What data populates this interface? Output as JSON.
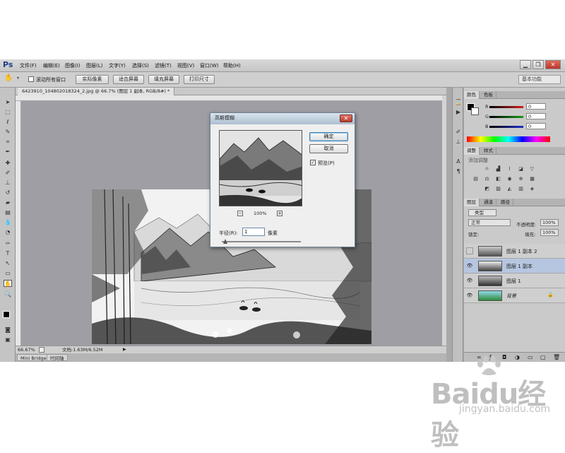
{
  "app": {
    "logo": "Ps"
  },
  "menu": [
    "文件(F)",
    "编辑(E)",
    "图像(I)",
    "图层(L)",
    "文字(Y)",
    "选择(S)",
    "滤镜(T)",
    "视图(V)",
    "窗口(W)",
    "帮助(H)"
  ],
  "window_controls": {
    "minimize": "▁",
    "restore": "❐",
    "close": "✕"
  },
  "options": {
    "scroll_all_label": "滚动所有窗口",
    "buttons": [
      "实际像素",
      "适合屏幕",
      "填充屏幕",
      "打印尺寸"
    ],
    "workspace": "基本功能"
  },
  "document": {
    "tab_title": "6423910_104802018324_2.jpg @ 66.7% (图层 1 副本, RGB/8#) *",
    "zoom": "66.67%",
    "doc_info": "文档:1.63M/6.52M"
  },
  "bottom_tabs": [
    "Mini Bridge",
    "时间轴"
  ],
  "dialog": {
    "title": "高斯模糊",
    "ok": "确定",
    "cancel": "取消",
    "preview_label": "预览(P)",
    "preview_checked": "✓",
    "zoom_value": "100%",
    "zoom_minus": "−",
    "zoom_plus": "+",
    "radius_label": "半径(R):",
    "radius_value": "1",
    "radius_unit": "像素",
    "close": "✕"
  },
  "panels": {
    "color_tabs": [
      "颜色",
      "色板"
    ],
    "channels": [
      {
        "label": "R",
        "value": "0",
        "color": "#d42020"
      },
      {
        "label": "G",
        "value": "0",
        "color": "#1a9c1a"
      },
      {
        "label": "B",
        "value": "0",
        "color": "#2030c8"
      }
    ],
    "adjust_tabs": [
      "调整",
      "样式"
    ],
    "adjust_title": "添加调整",
    "layers_tabs": [
      "图层",
      "通道",
      "路径"
    ],
    "kind_label": "类型",
    "blend_mode": "正常",
    "opacity_label": "不透明度:",
    "opacity_value": "100%",
    "lock_label": "锁定:",
    "fill_label": "填充:",
    "fill_value": "100%",
    "layers": [
      {
        "name": "图层 1 副本 2",
        "visible": false,
        "selected": false
      },
      {
        "name": "图层 1 副本",
        "visible": true,
        "selected": true
      },
      {
        "name": "图层 1",
        "visible": true,
        "selected": false
      },
      {
        "name": "背景",
        "visible": true,
        "selected": false,
        "locked": true
      }
    ],
    "eye_icon": "👁",
    "lock_icon": "🔒"
  },
  "watermark": {
    "word": "Baidu经验",
    "sub": "jingyan.baidu.com"
  }
}
